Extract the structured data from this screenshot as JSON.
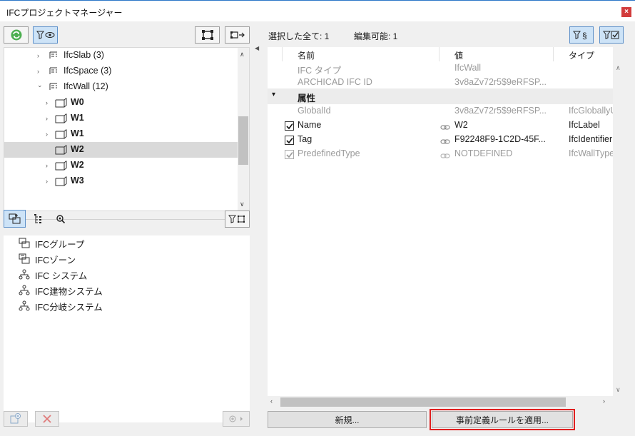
{
  "window": {
    "title": "IFCプロジェクトマネージャー",
    "close_glyph": "×"
  },
  "left_toolbar": {
    "refresh_icon": "refresh-icon",
    "filter_view_icon": "filter-eye-icon",
    "structure_icon": "structure-icon",
    "move_node_icon": "move-node-icon"
  },
  "tree": {
    "rows": [
      {
        "label": "IfcSlab (3)",
        "bold": false,
        "chevron": "›",
        "icon": "ifc-type-icon"
      },
      {
        "label": "IfcSpace (3)",
        "bold": false,
        "chevron": "›",
        "icon": "ifc-type-icon"
      },
      {
        "label": "IfcWall (12)",
        "bold": false,
        "chevron": "⌄",
        "icon": "ifc-type-icon"
      },
      {
        "label": "W0",
        "bold": true,
        "chevron": "›",
        "icon": "wall-icon"
      },
      {
        "label": "W1",
        "bold": true,
        "chevron": "›",
        "icon": "wall-icon"
      },
      {
        "label": "W1",
        "bold": true,
        "chevron": "›",
        "icon": "wall-icon"
      },
      {
        "label": "W2",
        "bold": true,
        "chevron": "",
        "icon": "wall-icon",
        "selected": true
      },
      {
        "label": "W2",
        "bold": true,
        "chevron": "›",
        "icon": "wall-icon"
      },
      {
        "label": "W3",
        "bold": true,
        "chevron": "›",
        "icon": "wall-icon"
      }
    ]
  },
  "group_tabs": {
    "groups_icon": "groups-icon",
    "hierarchy_icon": "hierarchy-icon",
    "search_icon": "search-icon",
    "filter_icon": "filter-icon"
  },
  "groups": {
    "items": [
      {
        "label": "IFCグループ",
        "icon": "group-icon"
      },
      {
        "label": "IFCゾーン",
        "icon": "zone-icon"
      },
      {
        "label": "IFC システム",
        "icon": "system-icon"
      },
      {
        "label": "IFC建物システム",
        "icon": "building-system-icon"
      },
      {
        "label": "IFC分岐システム",
        "icon": "distribution-system-icon"
      }
    ]
  },
  "right": {
    "selected_all_label": "選択した全て: 1",
    "editable_label": "編集可能: 1",
    "columns": {
      "name": "名前",
      "value": "値",
      "type": "タイプ"
    },
    "rows": [
      {
        "name": "IFC タイプ",
        "value": "IfcWall",
        "type": ""
      },
      {
        "name": "ARCHICAD IFC ID",
        "value": "3v8aZv72r5$9eRFSP...",
        "type": ""
      }
    ],
    "section": {
      "name": "属性",
      "collapse_glyph": "▾"
    },
    "attrs": [
      {
        "name": "GlobalId",
        "value": "3v8aZv72r5$9eRFSP...",
        "type": "IfcGloballyUniqueId",
        "checkbox": false,
        "link": false,
        "dim": true
      },
      {
        "name": "Name",
        "value": "W2",
        "type": "IfcLabel",
        "checkbox": true,
        "link": true,
        "dim": false
      },
      {
        "name": "Tag",
        "value": "F92248F9-1C2D-45F...",
        "type": "IfcIdentifier",
        "checkbox": true,
        "link": true,
        "dim": false
      },
      {
        "name": "PredefinedType",
        "value": "NOTDEFINED",
        "type": "IfcWallTypeEnum",
        "checkbox": true,
        "link": true,
        "dim": true
      }
    ],
    "new_button": "新規...",
    "apply_button": "事前定義ルールを適用..."
  }
}
